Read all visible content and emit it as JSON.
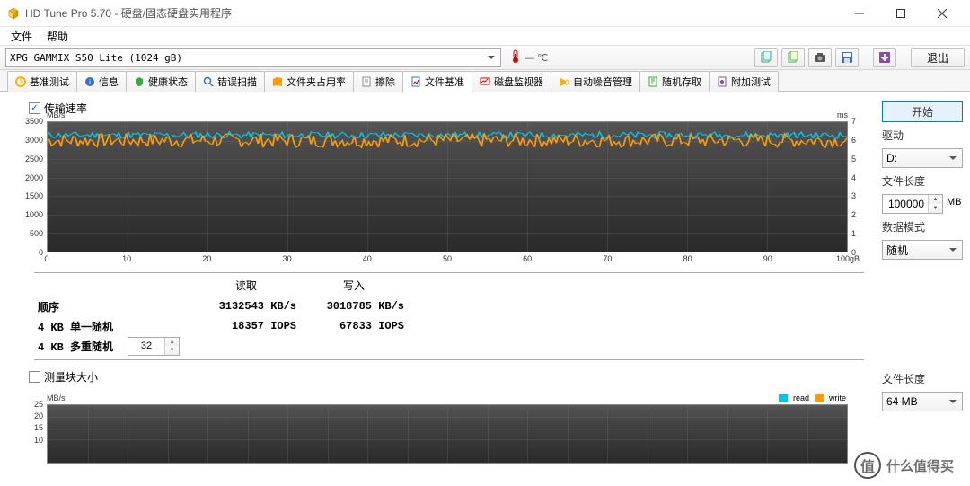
{
  "window": {
    "title": "HD Tune Pro 5.70 - 硬盘/固态硬盘实用程序"
  },
  "menu": {
    "file": "文件",
    "help": "帮助"
  },
  "toolbar": {
    "drive": "XPG GAMMIX S50 Lite (1024 gB)",
    "temp": "— ℃",
    "exit": "退出"
  },
  "tabs": {
    "items": [
      {
        "label": "基准测试"
      },
      {
        "label": "信息"
      },
      {
        "label": "健康状态"
      },
      {
        "label": "错误扫描"
      },
      {
        "label": "文件夹占用率"
      },
      {
        "label": "擦除"
      },
      {
        "label": "文件基准"
      },
      {
        "label": "磁盘监视器"
      },
      {
        "label": "自动噪音管理"
      },
      {
        "label": "随机存取"
      },
      {
        "label": "附加测试"
      }
    ]
  },
  "panel": {
    "chk_transfer": "传输速率",
    "chk_block": "测量块大小",
    "chart1_unit_left": "MB/s",
    "chart1_unit_right": "ms",
    "x_unit": "100gB",
    "legend_read": "read",
    "legend_write": "write",
    "results": {
      "read_h": "读取",
      "write_h": "写入",
      "seq_l": "顺序",
      "single_l": "4 KB 单一随机",
      "multi_l": "4 KB 多重随机",
      "seq_read": "3132543 KB/s",
      "seq_write": "3018785 KB/s",
      "single_read": "18357 IOPS",
      "single_write": "67833 IOPS",
      "queue": "32"
    }
  },
  "side": {
    "start": "开始",
    "drive_l": "驱动",
    "drive_v": "D:",
    "filelen_l": "文件长度",
    "filelen_v": "100000",
    "filelen_u": "MB",
    "pattern_l": "数据模式",
    "pattern_v": "随机",
    "filelen2_l": "文件长度",
    "filelen2_v": "64 MB"
  },
  "watermark": {
    "badge": "值",
    "text": "什么值得买"
  },
  "chart_data": [
    {
      "type": "line",
      "title": "传输速率",
      "xlabel": "gB",
      "ylabel_left": "MB/s",
      "ylabel_right": "ms",
      "xlim": [
        0,
        100
      ],
      "ylim_left": [
        0,
        3500
      ],
      "ylim_right": [
        0,
        7
      ],
      "y_ticks_left": [
        0,
        500,
        1000,
        1500,
        2000,
        2500,
        3000,
        3500
      ],
      "y_ticks_right": [
        0,
        1,
        2,
        3,
        4,
        5,
        6,
        7
      ],
      "x_ticks": [
        0,
        10,
        20,
        30,
        40,
        50,
        60,
        70,
        80,
        90,
        100
      ],
      "series": [
        {
          "name": "read",
          "color": "#00c4e8",
          "approx_mean": 3130,
          "approx_range": [
            2950,
            3200
          ]
        },
        {
          "name": "write",
          "color": "#ff9a00",
          "approx_mean": 3020,
          "approx_range": [
            2750,
            3150
          ]
        }
      ],
      "note": "dense jitter across whole range; values approximated from axis"
    },
    {
      "type": "line",
      "title": "测量块大小",
      "ylabel_left": "MB/s",
      "ylim_left": [
        0,
        25
      ],
      "y_ticks_left": [
        10,
        15,
        20,
        25
      ],
      "series": [
        {
          "name": "read",
          "color": "#00c4e8",
          "values": []
        },
        {
          "name": "write",
          "color": "#ff9a00",
          "values": []
        }
      ],
      "note": "empty (no data plotted)"
    }
  ]
}
